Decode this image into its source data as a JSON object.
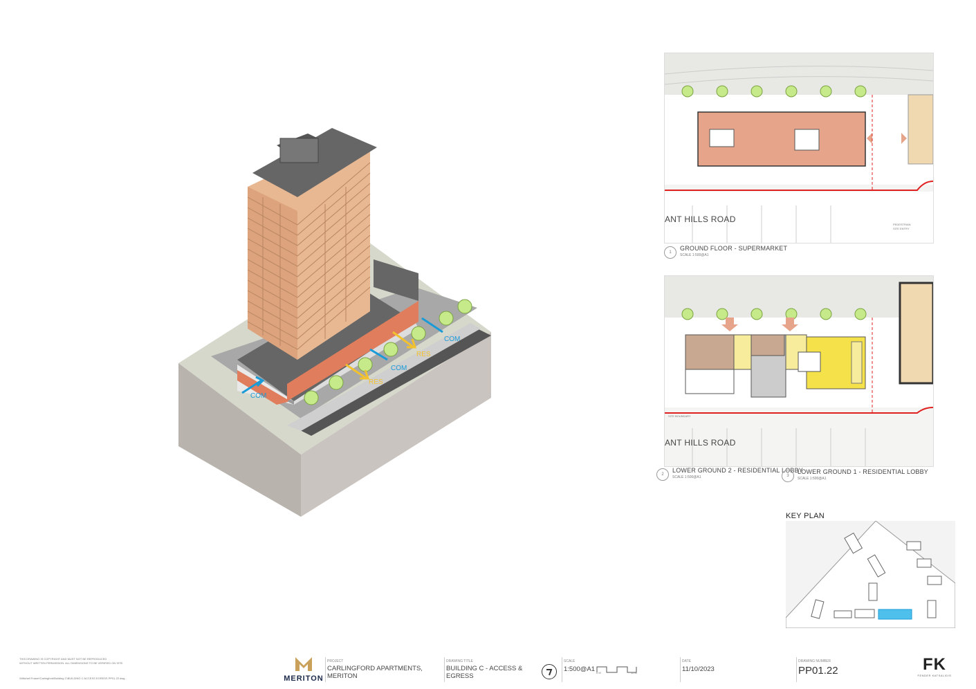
{
  "view": {
    "labels": [
      {
        "text": "COM",
        "color": "#1a9bd7"
      },
      {
        "text": "RES",
        "color": "#f2c12e"
      },
      {
        "text": "RES",
        "color": "#f2c12e"
      },
      {
        "text": "COM",
        "color": "#1a9bd7"
      },
      {
        "text": "COM",
        "color": "#1a9bd7"
      }
    ]
  },
  "plans": {
    "road_name": "ANT HILLS ROAD",
    "plan1": {
      "num": "1",
      "title": "GROUND FLOOR - SUPERMARKET",
      "scale": "SCALE 1:500@A1",
      "notes": [
        "PEDESTRIAN",
        "SITE ENTRY"
      ]
    },
    "plan2": {
      "num": "2",
      "title": "LOWER GROUND 2 - RESIDENTIAL LOBBY",
      "scale": "SCALE 1:500@A1"
    },
    "plan3": {
      "num": "3",
      "title": "LOWER GROUND 1 - RESIDENTIAL LOBBY",
      "scale": "SCALE 1:500@A1"
    },
    "boundary_label": "SITE BOUNDARY"
  },
  "key_plan": {
    "title": "KEY PLAN"
  },
  "title_block": {
    "disclaimer": [
      "THIS DRAWING IS COPYRIGHT AND MUST NOT BE REPRODUCED",
      "WITHOUT WRITTEN PERMISSION. ALL DIMENSIONS TO BE VERIFIED ON SITE."
    ],
    "path": "\\\\Mitchell Fraser\\Carlingford\\Building C\\BUILDING C ACCESS EGRESS PP01.22.dwg",
    "brand": "MERITON",
    "project_label": "PROJECT",
    "project": [
      "CARLINGFORD APARTMENTS,",
      "MERITON"
    ],
    "drawing_title_label": "DRAWING TITLE",
    "drawing_title": [
      "BUILDING C - ACCESS &",
      "EGRESS"
    ],
    "scale_label": "SCALE",
    "scale": "1:500@A1",
    "scale_marks": [
      "0 M",
      "10 M"
    ],
    "date_label": "DATE",
    "date": "11/10/2023",
    "number_label": "DRAWING NUMBER",
    "number": "PP01.22",
    "firm_logo": "FK",
    "firm_name": "FENDER KATSALIDIS"
  },
  "colors": {
    "accent_com": "#1a9bd7",
    "accent_res": "#f2c12e",
    "site_boundary": "#e02020",
    "retail": "#e6a48a",
    "lobby": "#f5e24a",
    "facade": "#e8b892",
    "roof": "#666666"
  }
}
